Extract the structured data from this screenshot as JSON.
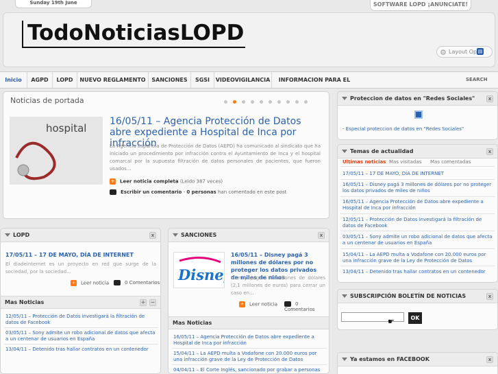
{
  "top": {
    "date": "Sunday 19th June",
    "promo": "SOFTWARE LOPD ¡ANUNCIATE!"
  },
  "header": {
    "logo": "TodoNoticiasLOPD",
    "layout_label": "Layout Op"
  },
  "nav": {
    "items": [
      "Inicio",
      "AGPD",
      "LOPD",
      "NUEVO REGLAMENTO",
      "SANCIONES",
      "SGSI",
      "VIDEOVIGILANCIA",
      "INFORMACION PARA EL USUARIO"
    ],
    "search": "SEARCH"
  },
  "featured": {
    "section": "Noticias de portada",
    "image_word": "hospital",
    "headline": "16/05/11 – Agencia Protección de Datos abre expediente a Hospital de Inca por infracción",
    "body": "La Agencia Española de Protección de Datos (AEPD) ha comunicado al sindicato que ha iniciado un procedimiento por infracción contra el Ayuntamiento de Inca y el hospital comarcal por la supuesta filtración de datos personales de pacientes, que fueron usados...",
    "read_label": "Leer noticia completa",
    "read_count": "(Leido 387 veces)",
    "comment_label": "Escribir un comentario",
    "comment_count": "0 personas",
    "comment_tail": "han comentado en este post"
  },
  "lopd": {
    "title": "LOPD",
    "article_title": "17/05/11 – 17 DE MAYO, DÍA DE INTERNET",
    "article_body": "El diadeinternet es un proyecto en red que surge de la sociedad, por la sociedad...",
    "read": "Leer noticia",
    "comments": "0 Comentarios",
    "more_title": "Mas Noticias",
    "more": [
      "12/05/11 – Protección de Datos investigará la filtración de datos de Facebook",
      "03/05/11 – Sony admite un robo adicional de datos que afecta a un centenar de usuarios en España",
      "13/04/11 – Detenido tras hallar contratos en un contenedor"
    ]
  },
  "sanciones": {
    "title": "SANCIONES",
    "image_word": "Disney",
    "article_title": "16/05/11 – Disney pagá 3 millones de dólares por no proteger los datos privados de miles de niños",
    "article_body": "Disney pagará 3 millones de dólares (2,1 millones de euros) para cerrar un caso en...",
    "read": "Leer noticia",
    "comments": "0 Comentarios",
    "more_title": "Mas Noticias",
    "more": [
      "16/05/11 – Agencia Protección de Datos abre expediente a Hospital de Inca por infracción",
      "15/04/11 – La AEPD multa a Vodafone con 20.000 euros por una infracción grave de la Ley de Protección de Datos",
      "04/04/11 – El Corte Inglés, sancionado por grabar a personas"
    ]
  },
  "redes": {
    "title": "Proteccion de datos en \"Redes Sociales\"",
    "link": "- Especial proteccion de datos en \"Redes Sociales\""
  },
  "temas": {
    "title": "Temas de actualidad",
    "tabs": [
      "Ultimas noticias",
      "Mas visitadas",
      "Mas comentadas"
    ],
    "items": [
      "17/05/11 – 17 DE MAYO, DÍA DE INTERNET",
      "16/05/11 – Disney pagá 3 millones de dólares por no proteger los datos privados de miles de niños",
      "16/05/11 – Agencia Protección de Datos abre expediente a Hospital de Inca por infracción",
      "12/05/11 – Protección de Datos investigará la filtración de datos de Facebook",
      "03/05/11 – Sony admite un robo adicional de datos que afecta a un centenar de usuarios en España",
      "15/04/11 – La AEPD multa a Vodafone con 20.000 euros por una infracción grave de la Ley de Protección de Datos",
      "13/04/11 – Detenido tras hallar contratos en un contenedor"
    ]
  },
  "boletin": {
    "title": "SUBSCRIPCIÓN BOLETÍN DE NOTICIAS",
    "ok": "OK"
  },
  "facebook": {
    "title": "Ya estamos en FACEBOOK"
  },
  "colors": {
    "accent": "#2b62b0",
    "orange": "#ff7a12"
  }
}
